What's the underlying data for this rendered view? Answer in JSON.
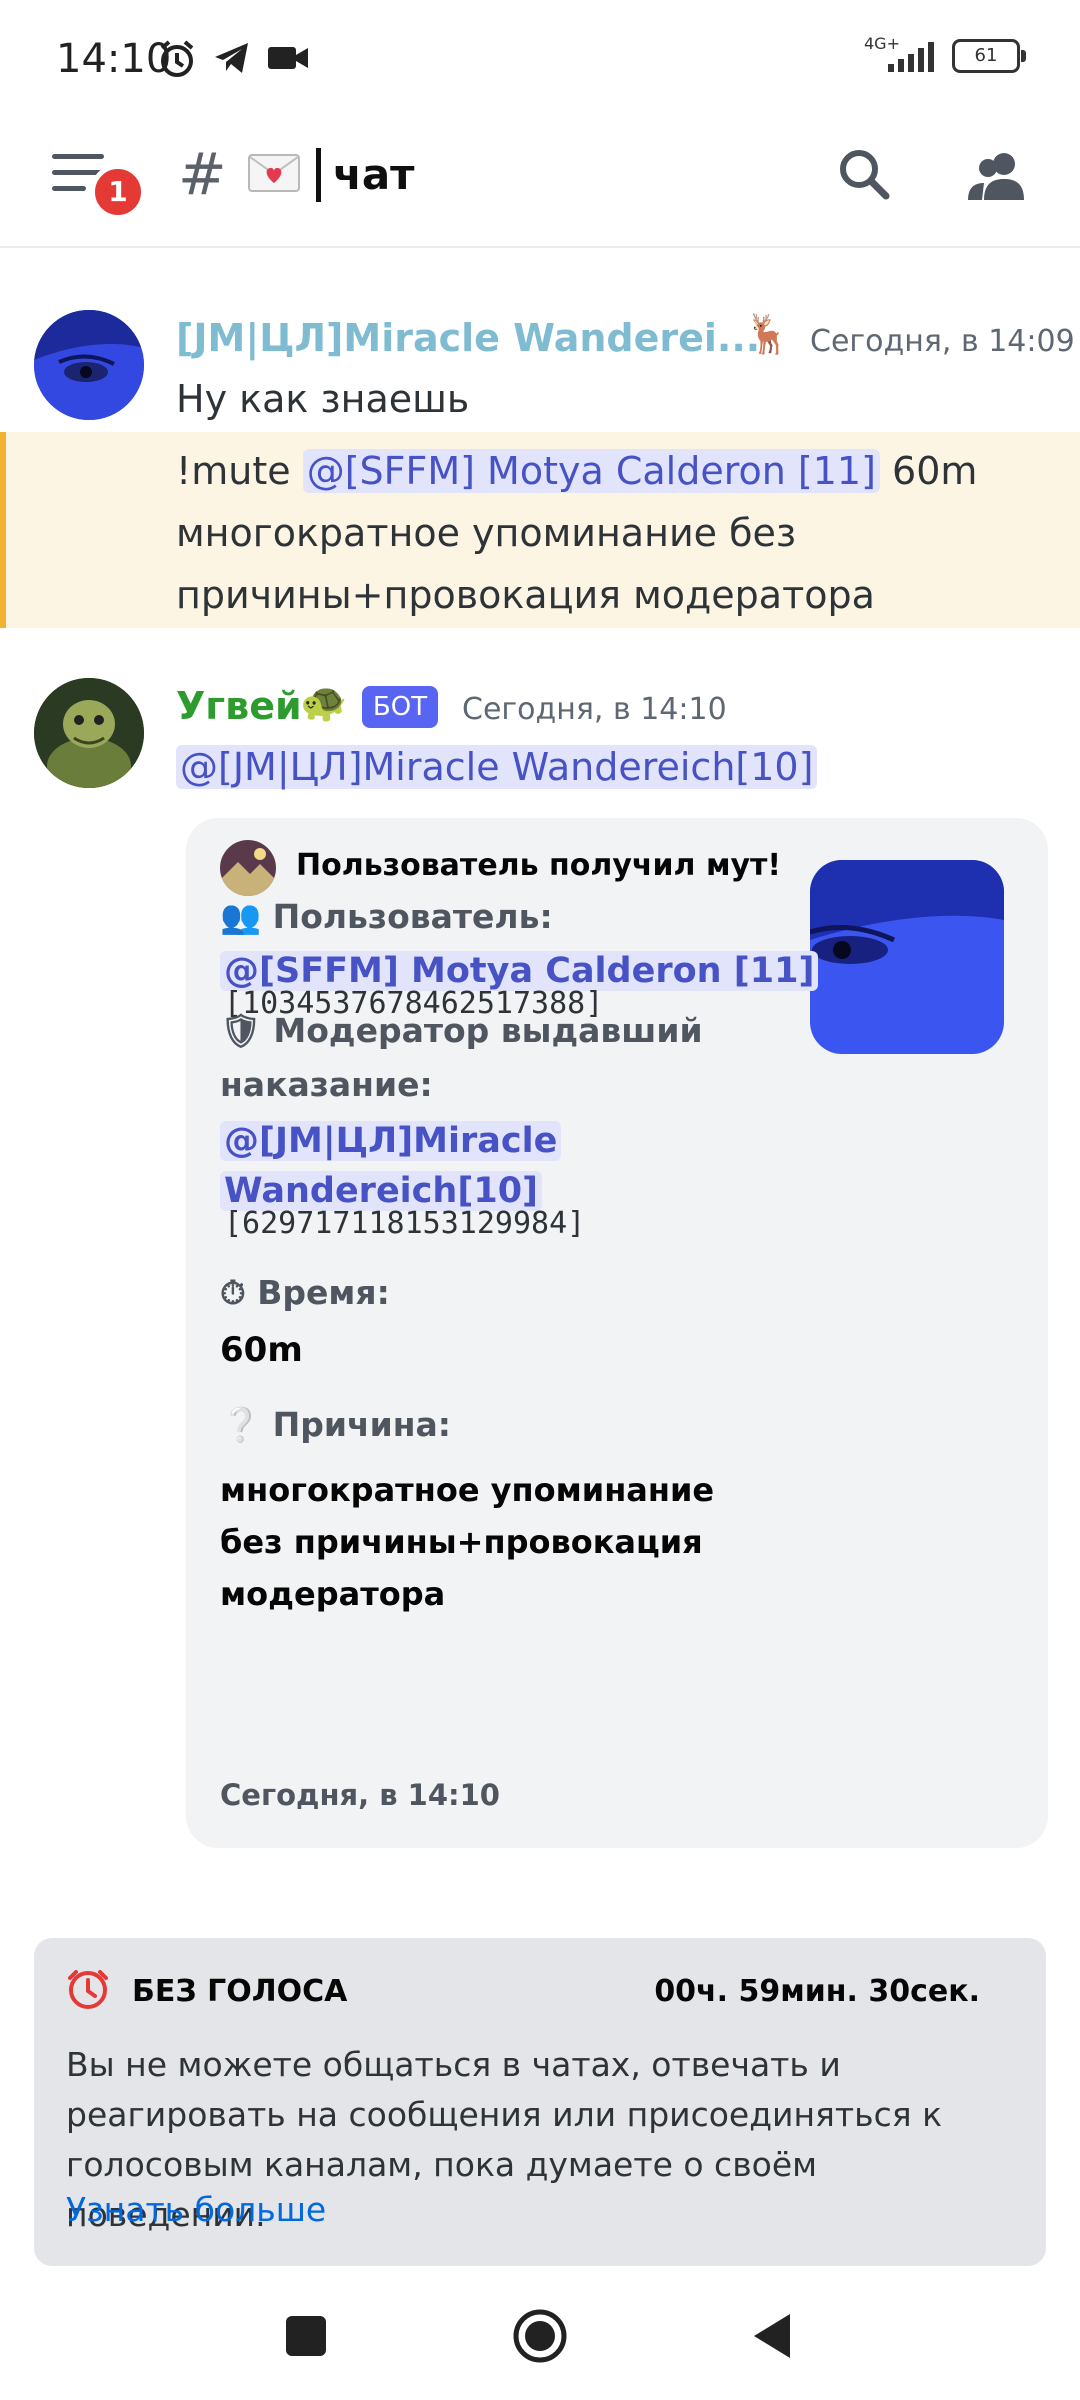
{
  "status_bar": {
    "time": "14:10",
    "network": "4G+",
    "battery": "61"
  },
  "header": {
    "notification_count": "1",
    "channel_emoji": "💌",
    "channel_name": "чат"
  },
  "messages": [
    {
      "author": "[JM|ЦЛ]Miracle Wanderei...",
      "author_color": "#7fbcd2",
      "role_icon": "🦌",
      "time": "Сегодня, в 14:09",
      "line1": "Ну как знаешь",
      "cmd_prefix": "!mute ",
      "mention": "@[SFFM] Motya Calderon [11]",
      "cmd_suffix": " 60m",
      "line2": "многократное упоминание без",
      "line3": "причины+провокация модератора"
    },
    {
      "author": "Угвей",
      "author_color": "#2e9b2e",
      "role_icon": "🐢",
      "bot_badge": "БОТ",
      "time": "Сегодня, в 14:10",
      "mention": "@[JM|ЦЛ]Miracle Wandereich[10]"
    }
  ],
  "embed": {
    "title": "Пользователь получил мут!",
    "user_field_icon": "👥",
    "user_field_label": "Пользователь:",
    "user_mention": "@[SFFM] Motya Calderon [11]",
    "user_id": "[1034537678462517388]",
    "mod_field_icon": "🛡",
    "mod_field_label_1": "Модератор выдавший",
    "mod_field_label_2": "наказание:",
    "mod_mention_1": "@[JM|ЦЛ]Miracle",
    "mod_mention_2": "Wandereich[10]",
    "mod_id": "[629717118153129984]",
    "time_field_icon": "⏱",
    "time_field_label": "Время:",
    "time_value": "60m",
    "reason_field_icon": "❔",
    "reason_field_label": "Причина:",
    "reason_line1": "многократное упоминание",
    "reason_line2": "без причины+провокация",
    "reason_line3": "модератора",
    "footer": "Сегодня, в 14:10"
  },
  "mute_notice": {
    "title": "БЕЗ ГОЛОСА",
    "timer": "00ч. 59мин. 30сек.",
    "line1": "Вы не можете общаться в чатах, отвечать и",
    "line2": "реагировать на сообщения или присоединяться к",
    "line3": "голосовым каналам, пока думаете о своём поведении.",
    "link": "Узнать больше"
  },
  "colors": {
    "accent": "#5865f2",
    "mention_bg": "#e1e4fb",
    "mention_text": "#4752c4",
    "highlight_bg": "#fdf5e4",
    "highlight_bar": "#f0b232",
    "danger": "#e53935",
    "link": "#0068e0"
  }
}
